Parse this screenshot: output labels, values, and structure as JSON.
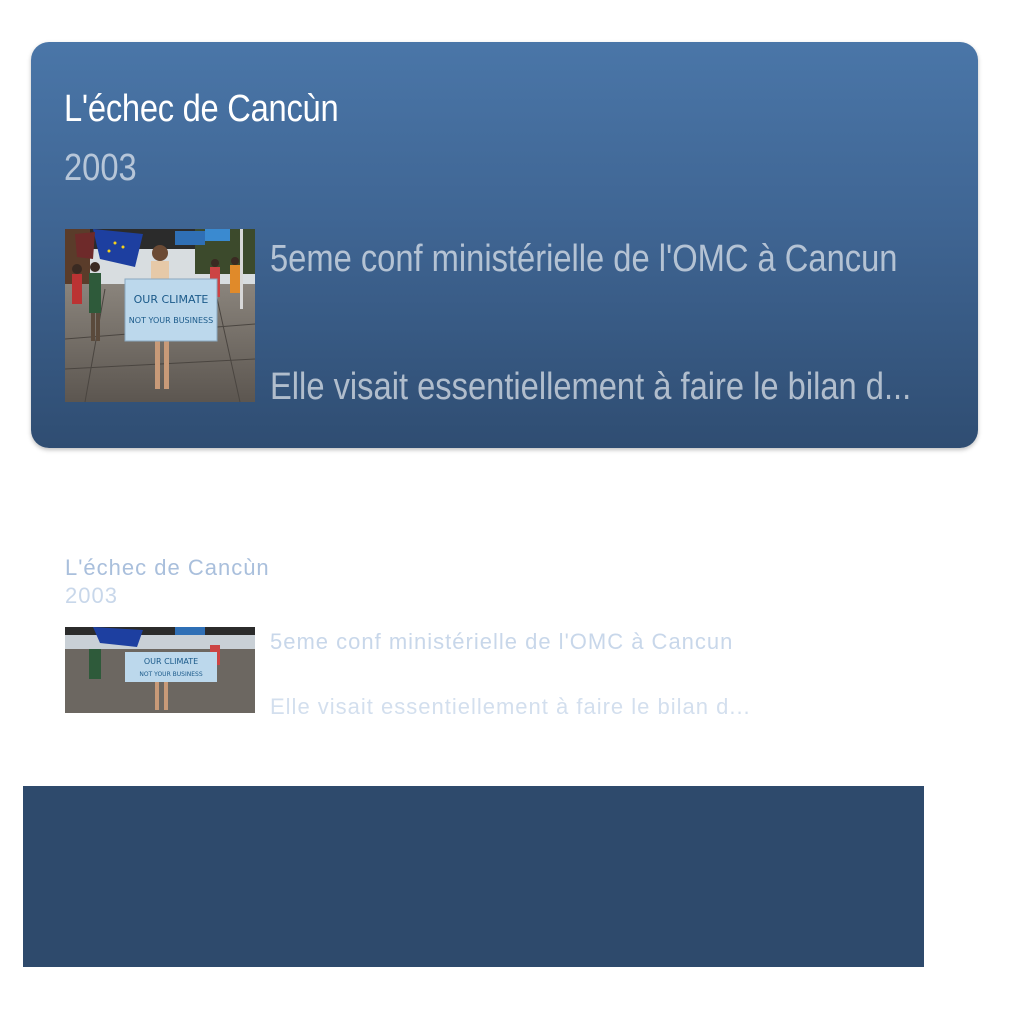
{
  "event_card": {
    "title": "L'échec de Cancùn",
    "year": "2003",
    "subtitle": "5eme conf ministérielle de l'OMC à Cancun",
    "description": "Elle visait essentiellement à faire le bilan d...",
    "photo": {
      "sign_line1": "OUR CLIMATE",
      "sign_line2": "NOT YOUR BUSINESS"
    }
  },
  "reflection": {
    "title": "L'échec de Cancùn",
    "year": "2003",
    "subtitle": "5eme conf ministérielle de l'OMC à Cancun",
    "description": "Elle visait essentiellement à faire le bilan d..."
  },
  "colors": {
    "card_top": "#4a76a8",
    "card_bottom": "#2f4d72",
    "bottom_panel": "#2e4a6c",
    "reflection_text": "#a9bfdc"
  }
}
